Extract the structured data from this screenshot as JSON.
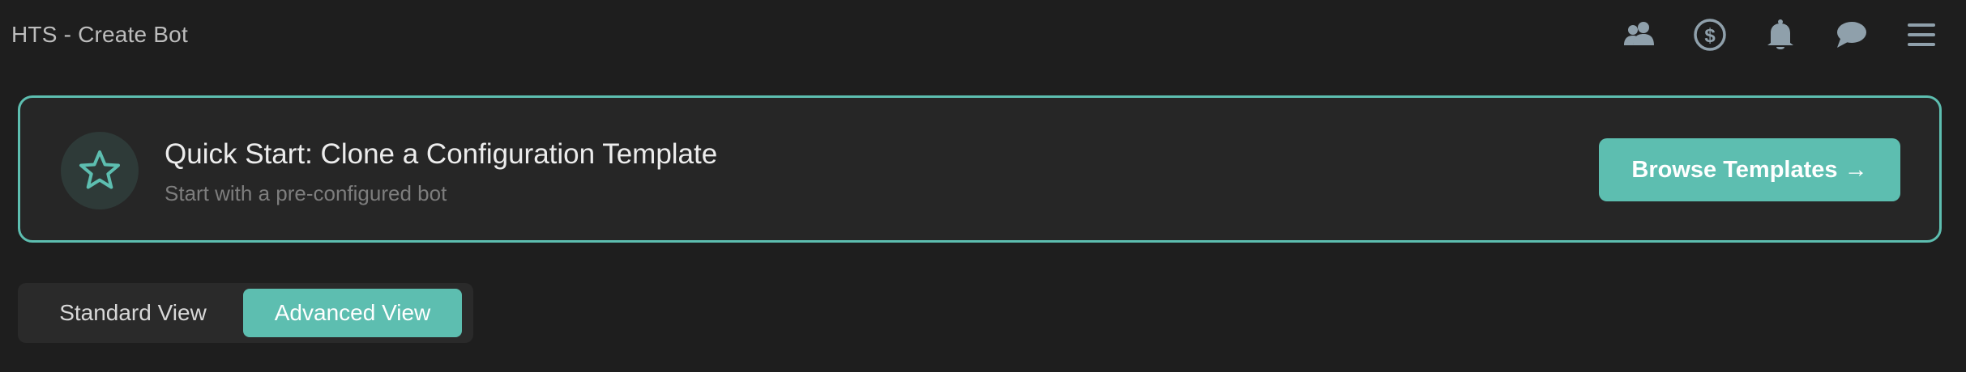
{
  "header": {
    "title": "HTS - Create Bot",
    "icons": [
      "users-icon",
      "dollar-icon",
      "bell-icon",
      "chat-icon",
      "menu-icon"
    ]
  },
  "quick_start": {
    "title": "Quick Start: Clone a Configuration Template",
    "subtitle": "Start with a pre-configured bot",
    "button_label": "Browse Templates →",
    "icon": "star-icon"
  },
  "view_toggle": {
    "standard_label": "Standard View",
    "advanced_label": "Advanced View",
    "selected": "Advanced View"
  },
  "colors": {
    "accent": "#5dbeb0",
    "background": "#1e1e1e",
    "panel": "#262626",
    "icon": "#8fa0ab"
  }
}
